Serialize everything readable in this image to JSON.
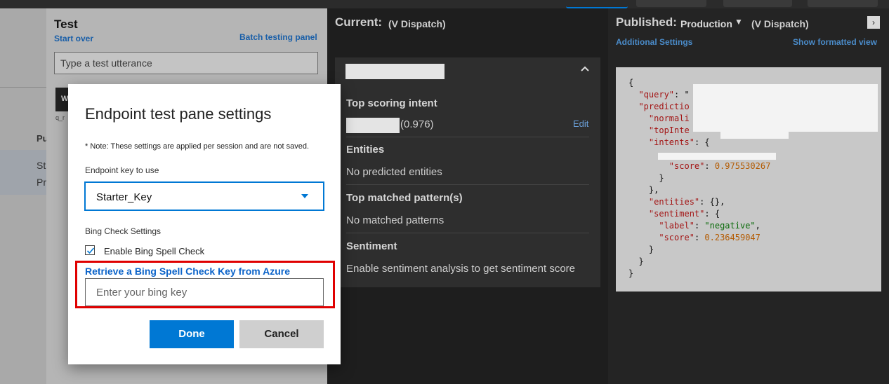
{
  "test_panel": {
    "title": "Test",
    "start_over": "Start over",
    "batch_testing": "Batch testing panel",
    "utterance_placeholder": "Type a test utterance",
    "chip_text": "W",
    "tiny_text": "q_r"
  },
  "left_page": {
    "col_header": "Pu",
    "row_line1": "Sta",
    "row_line2": "Pr"
  },
  "current": {
    "heading": "Current:",
    "sub": "(V Dispatch)",
    "top_scoring_intent": "Top scoring intent",
    "intent_score": "(0.976)",
    "edit": "Edit",
    "entities_heading": "Entities",
    "entities_text": "No predicted entities",
    "patterns_heading": "Top matched pattern(s)",
    "patterns_text": "No matched patterns",
    "sentiment_heading": "Sentiment",
    "sentiment_text": "Enable sentiment analysis to get sentiment score"
  },
  "published": {
    "heading": "Published:",
    "environment": "Production",
    "sub": "(V Dispatch)",
    "additional_settings": "Additional Settings",
    "show_formatted": "Show formatted view",
    "json": {
      "open": "{",
      "query_key": "\"query\"",
      "query_colon": ": \"",
      "prediction_key": "\"predictio",
      "normalized_key": "\"normali",
      "top_intent_key": "\"topInte",
      "intents_key": "\"intents\"",
      "score_key": "\"score\"",
      "score_value": "0.975530267",
      "entities_key": "\"entities\"",
      "entities_value": "{}",
      "sentiment_key": "\"sentiment\"",
      "label_key": "\"label\"",
      "label_value": "\"negative\"",
      "sentiment_score_key": "\"score\"",
      "sentiment_score_value": "0.236459047"
    }
  },
  "dialog": {
    "title": "Endpoint test pane settings",
    "note": "* Note: These settings are applied per session and are not saved.",
    "endpoint_key_label": "Endpoint key to use",
    "endpoint_key_value": "Starter_Key",
    "bing_section_label": "Bing Check Settings",
    "enable_bing_label": "Enable Bing Spell Check",
    "enable_bing_checked": true,
    "retrieve_link": "Retrieve a Bing Spell Check Key from Azure",
    "bing_key_placeholder": "Enter your bing key",
    "done": "Done",
    "cancel": "Cancel"
  },
  "colors": {
    "accent": "#0078d4",
    "highlight_box": "#e00000"
  }
}
